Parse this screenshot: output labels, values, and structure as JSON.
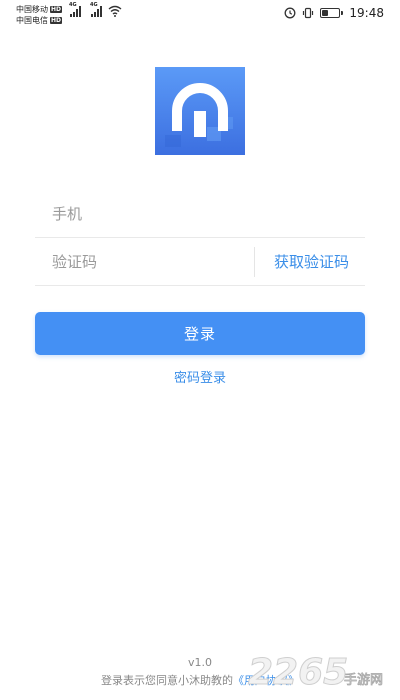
{
  "status_bar": {
    "carrier_1": "中国移动",
    "carrier_2": "中国电信",
    "hd_badge": "HD",
    "network_1": "4G",
    "network_2": "4G",
    "time": "19:48",
    "battery_level": 0.35,
    "icons": [
      "signal-icon",
      "wifi-icon",
      "alarm-icon",
      "vibrate-icon",
      "battery-icon"
    ]
  },
  "logo": {
    "icon": "headphones-logo-icon",
    "colors": {
      "top": "#5b9af7",
      "bottom": "#3c6fe0"
    }
  },
  "form": {
    "phone": {
      "placeholder": "手机",
      "value": ""
    },
    "code": {
      "placeholder": "验证码",
      "value": ""
    },
    "get_code_label": "获取验证码",
    "login_label": "登录",
    "password_login_label": "密码登录"
  },
  "footer": {
    "version": "v1.0",
    "agreement_text": "登录表示您同意小沐助教的",
    "agreement_link": "《用户协议》"
  },
  "watermark": {
    "number": "2265",
    "suffix": "手游网"
  },
  "colors": {
    "accent": "#4490f4",
    "link": "#3a8ee8",
    "placeholder": "#9a9a9a"
  }
}
